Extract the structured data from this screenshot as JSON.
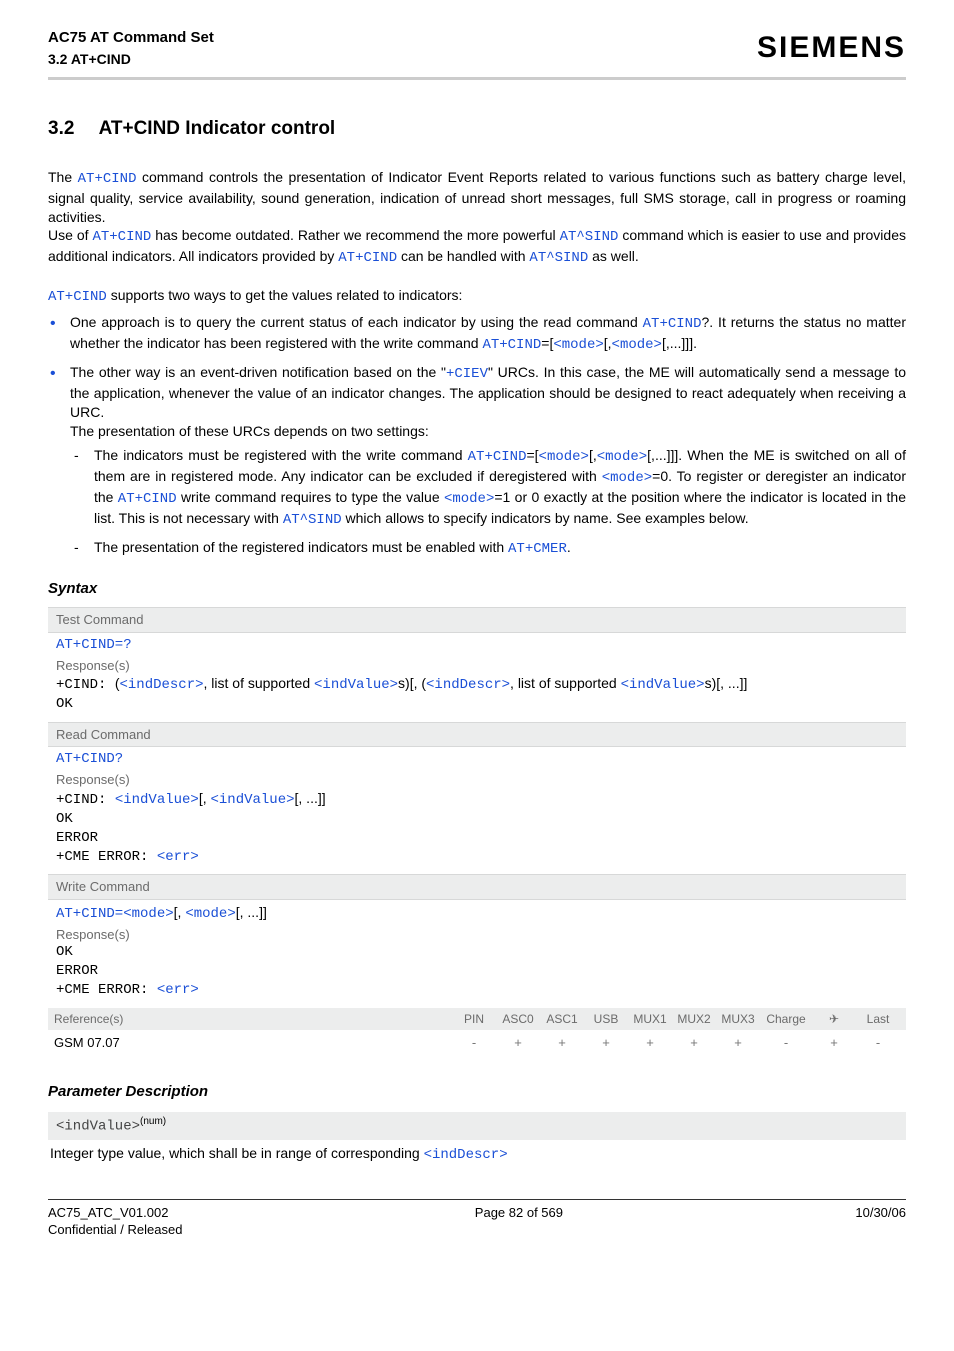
{
  "header": {
    "title": "AC75 AT Command Set",
    "subtitle": "3.2 AT+CIND",
    "brand": "SIEMENS"
  },
  "section": {
    "number": "3.2",
    "title": "AT+CIND   Indicator control"
  },
  "intro": {
    "p1_a": "The ",
    "p1_cmd1": "AT+CIND",
    "p1_b": " command controls the presentation of Indicator Event Reports related to various functions such as battery charge level, signal quality, service availability, sound generation, indication of unread short messages, full SMS storage, call in progress or roaming activities.",
    "p2_a": "Use of ",
    "p2_cmd1": "AT+CIND",
    "p2_b": " has become outdated. Rather we recommend the more powerful ",
    "p2_cmd2": "AT^SIND",
    "p2_c": " command which is easier to use and provides additional indicators. All indicators provided by ",
    "p2_cmd3": "AT+CIND",
    "p2_d": " can be handled with ",
    "p2_cmd4": "AT^SIND",
    "p2_e": " as well.",
    "p3_cmd": "AT+CIND",
    "p3_b": " supports two ways to get the values related to indicators:"
  },
  "bullets": {
    "b1_a": "One approach is to query the current status of each indicator by using the read command ",
    "b1_cmd": "AT+CIND",
    "b1_q": "?. It returns the status no matter whether the indicator has been registered with the write command ",
    "b1_cmd2": "AT+CIND",
    "b1_eq": "=[",
    "b1_mode1": "<mode>",
    "b1_mid": "[,",
    "b1_mode2": "<mode>",
    "b1_end": "[,...]]].",
    "b2_a": "The other way is an event-driven notification based on the \"",
    "b2_ciev": "+CIEV",
    "b2_b": "\" URCs. In this case, the ME will automatically send a message to the application, whenever the value of an indicator changes. The application should be designed to react adequately when receiving a URC.",
    "b2_c": "The presentation of these URCs depends on two settings:",
    "d1_a": "The indicators must be registered with the write command ",
    "d1_cmd": "AT+CIND",
    "d1_eq": "=[",
    "d1_mode1": "<mode>",
    "d1_mid": "[,",
    "d1_mode2": "<mode>",
    "d1_end": "[,...]]]. When the ME is switched on all of them are in registered mode. Any indicator can be excluded if deregistered with ",
    "d1_mode3": "<mode>",
    "d1_f": "=0. To register or deregister an indicator the ",
    "d1_cmd2": "AT+CIND",
    "d1_g": " write command requires to type the value ",
    "d1_mode4": "<mode>",
    "d1_h": "=1 or 0 exactly at the position where the indicator is located in the list. This is not necessary with ",
    "d1_cmd3": "AT^SIND",
    "d1_i": " which allows to specify indicators by name. See examples below.",
    "d2_a": "The presentation of the registered indicators must be enabled with ",
    "d2_cmd": "AT+CMER",
    "d2_b": "."
  },
  "syntax": {
    "heading": "Syntax",
    "test_label": "Test Command",
    "test_cmd": "AT+CIND=?",
    "resp_label": "Response(s)",
    "test_resp_a": "+CIND: ",
    "test_resp_open": "(",
    "indDescr": "<indDescr>",
    "test_resp_b": ", list of supported ",
    "indValue": "<indValue>",
    "test_resp_c": "s)[, (",
    "test_resp_d": ", list of supported ",
    "test_resp_e": "s)[, ...]]",
    "ok": "OK",
    "read_label": "Read Command",
    "read_cmd": "AT+CIND?",
    "read_resp_a": "+CIND: ",
    "read_resp_b": "[, ",
    "read_resp_c": "[, ...]]",
    "error": "ERROR",
    "cme": "+CME ERROR: ",
    "err": "<err>",
    "write_label": "Write Command",
    "write_cmd_a": "AT+CIND=",
    "mode": "<mode>",
    "write_cmd_b": "[, ",
    "write_cmd_c": "[, ...]]",
    "ref_label": "Reference(s)",
    "ref_value": "GSM 07.07",
    "cols": [
      "PIN",
      "ASC0",
      "ASC1",
      "USB",
      "MUX1",
      "MUX2",
      "MUX3",
      "Charge",
      "✈",
      "Last"
    ],
    "marks": [
      "-",
      "+",
      "+",
      "+",
      "+",
      "+",
      "+",
      "-",
      "+",
      "-"
    ]
  },
  "param": {
    "heading": "Parameter Description",
    "name": "<indValue>",
    "sup": "(num)",
    "desc_a": "Integer type value, which shall be in range of corresponding ",
    "desc_link": "<indDescr>"
  },
  "footer": {
    "left1": "AC75_ATC_V01.002",
    "left2": "Confidential / Released",
    "mid": "Page 82 of 569",
    "right": "10/30/06"
  }
}
